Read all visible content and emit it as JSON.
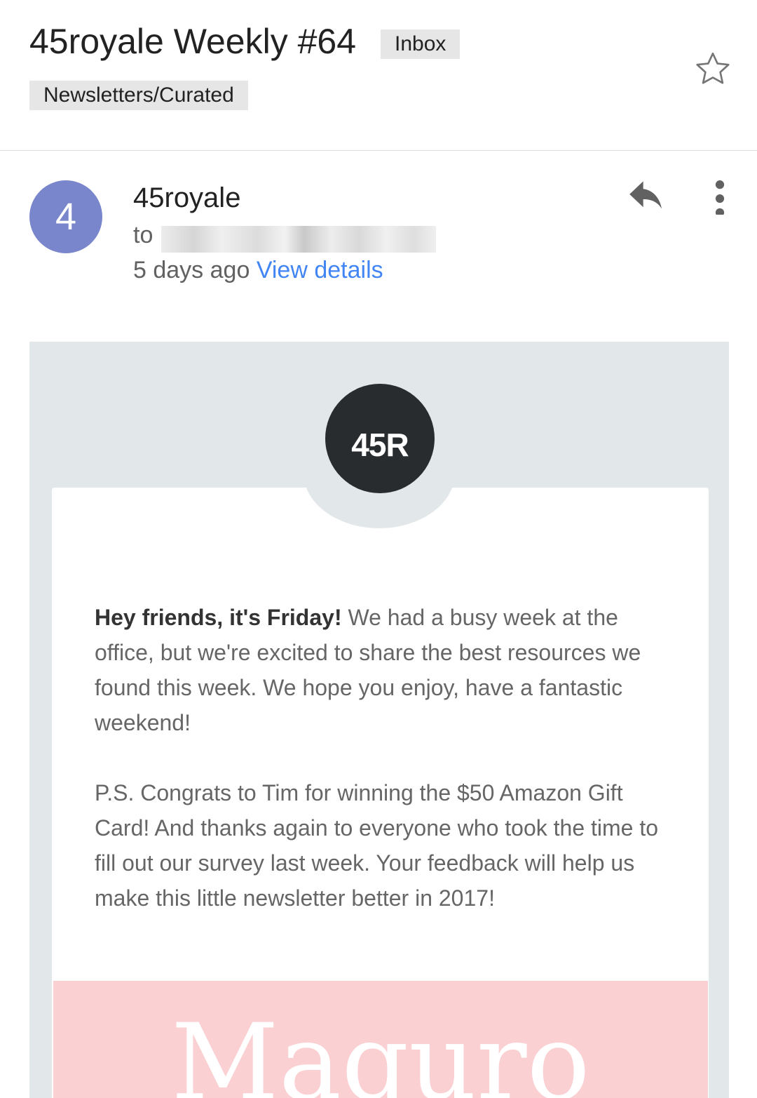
{
  "header": {
    "subject": "45royale Weekly #64",
    "labels": [
      "Inbox",
      "Newsletters/Curated"
    ],
    "star_icon": "star-outline-icon"
  },
  "message": {
    "avatar_letter": "4",
    "avatar_color": "#7986cb",
    "sender": "45royale",
    "to_prefix": "to",
    "date": "5 days ago",
    "view_details": "View details",
    "reply_icon": "reply-icon",
    "more_icon": "more-vert-icon"
  },
  "newsletter": {
    "logo_text": "45R",
    "intro_bold": "Hey friends, it's Friday!",
    "intro_rest": " We had a busy week at the office, but we're excited to share the best resources we found this week. We hope you enjoy, have a fantastic weekend!",
    "ps": "P.S. Congrats to Tim for winning the $50 Amazon Gift Card! And thanks again to everyone who took the time to fill out our survey last week. Your feedback will help us make this little newsletter better in 2017!",
    "banner_text": "Maguro",
    "banner_color": "#fbd0d3"
  },
  "colors": {
    "link": "#4285f4",
    "newsletter_bg": "#e2e8ea",
    "logo_bg": "#282c2f"
  }
}
